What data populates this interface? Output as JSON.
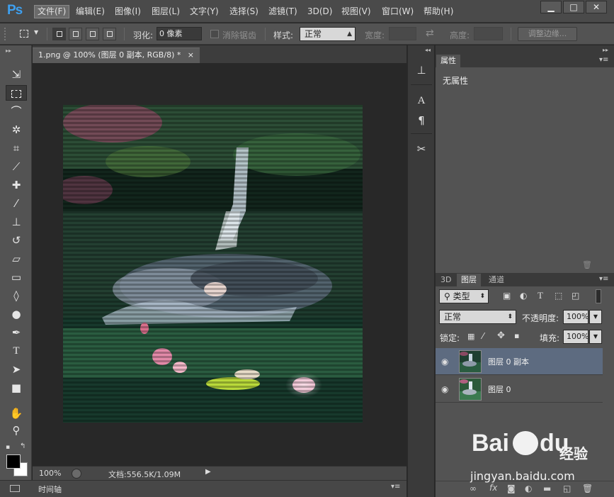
{
  "app": {
    "logo": "Ps"
  },
  "menu": {
    "items": [
      "文件(F)",
      "编辑(E)",
      "图像(I)",
      "图层(L)",
      "文字(Y)",
      "选择(S)",
      "滤镜(T)",
      "3D(D)",
      "视图(V)",
      "窗口(W)",
      "帮助(H)"
    ],
    "active_index": 0
  },
  "window_controls": {
    "minimize": "▁",
    "maximize": "□",
    "close": "✕"
  },
  "options": {
    "feather_label": "羽化:",
    "feather_value": "0 像素",
    "antialias_label": "消除锯齿",
    "style_label": "样式:",
    "style_value": "正常",
    "width_label": "宽度:",
    "height_label": "高度:",
    "refine_edge": "调整边缘..."
  },
  "document": {
    "tab_title": "1.png @ 100% (图层 0 副本, RGB/8) *",
    "tab_close": "×",
    "zoom": "100%",
    "doc_info": "文档:556.5K/1.09M"
  },
  "timeline": {
    "label": "时间轴"
  },
  "properties_panel": {
    "tab": "属性",
    "content": "无属性"
  },
  "layers_panel": {
    "tabs": [
      "3D",
      "图层",
      "通道"
    ],
    "active_tab": 1,
    "filter_label": "类型",
    "blend_mode": "正常",
    "opacity_label": "不透明度:",
    "opacity_value": "100%",
    "lock_label": "锁定:",
    "fill_label": "填充:",
    "fill_value": "100%",
    "layers": [
      {
        "name": "图层 0 副本",
        "selected": true
      },
      {
        "name": "图层 0",
        "selected": false
      }
    ]
  },
  "watermark": {
    "brand": "Bai",
    "brand2": "du",
    "cn": "经验",
    "url": "jingyan.baidu.com"
  },
  "colors": {
    "accent": "#3ea0f0",
    "selected_layer": "#5d6b80",
    "panel": "#535353",
    "canvas_bg": "#282828"
  }
}
